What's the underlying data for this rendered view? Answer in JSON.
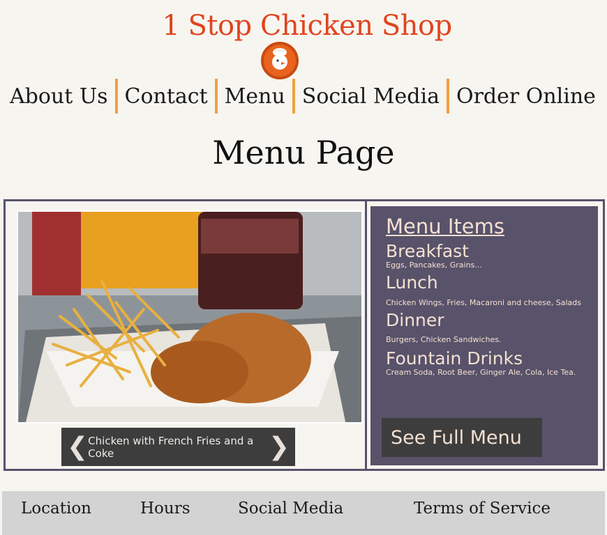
{
  "brand": {
    "title": "1 Stop Chicken Shop",
    "logo_icon": "chicken-chef-logo"
  },
  "nav": [
    {
      "label": "About Us"
    },
    {
      "label": "Contact"
    },
    {
      "label": "Menu"
    },
    {
      "label": "Social Media"
    },
    {
      "label": "Order Online"
    }
  ],
  "page": {
    "title": "Menu Page"
  },
  "slideshow": {
    "caption": "Chicken with French Fries and a Coke",
    "prev_icon": "chevron-left-icon",
    "next_icon": "chevron-right-icon"
  },
  "menu": {
    "heading": "Menu Items",
    "categories": [
      {
        "name": "Breakfast",
        "desc": "Eggs, Pancakes, Grains..."
      },
      {
        "name": "Lunch",
        "desc": "Chicken Wings, Fries, Macaroni and cheese, Salads"
      },
      {
        "name": "Dinner",
        "desc": "Burgers, Chicken Sandwiches."
      },
      {
        "name": "Fountain Drinks",
        "desc": "Cream Soda, Root Beer, Ginger Ale, Cola, Ice Tea."
      }
    ],
    "full_menu_label": "See Full Menu"
  },
  "footer": {
    "links": [
      {
        "label": "Location"
      },
      {
        "label": "Hours"
      },
      {
        "label": "Social Media"
      },
      {
        "label": "Terms of Service"
      }
    ]
  },
  "colors": {
    "brand": "#e0451e",
    "panel": "#58526a",
    "nav_separator": "#f0a040"
  }
}
